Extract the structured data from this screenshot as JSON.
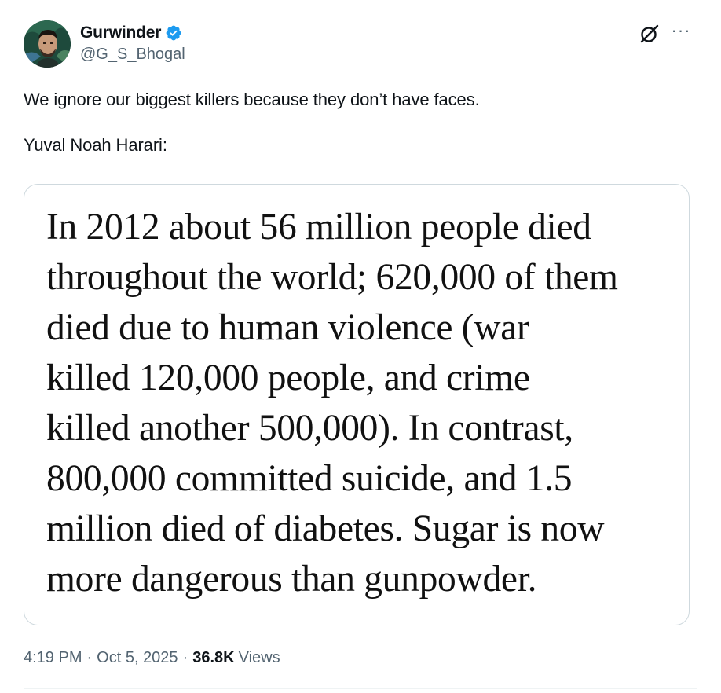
{
  "author": {
    "display_name": "Gurwinder",
    "handle": "@G_S_Bhogal",
    "verified": true,
    "verified_color": "#1d9bf0"
  },
  "icons": {
    "verified": "verified-badge-icon",
    "grok": "grok-icon",
    "more": "more-options-icon",
    "more_glyph": "···"
  },
  "tweet": {
    "text_line_1": "We ignore our biggest killers because they don’t have faces.",
    "text_line_2": "Yuval Noah Harari:"
  },
  "media": {
    "quote": "In 2012 about 56 million people died\nthroughout the world; 620,000 of them\ndied due to human violence (war\nkilled 120,000 people, and crime\nkilled another 500,000). In contrast,\n800,000 committed suicide, and 1.5\nmillion died of diabetes. Sugar is now\nmore dangerous than gunpowder."
  },
  "meta": {
    "time": "4:19 PM",
    "separator": "·",
    "date": "Oct 5, 2025",
    "views_count": "36.8K",
    "views_label": "Views"
  },
  "colors": {
    "text_primary": "#0f1419",
    "text_secondary": "#536471",
    "border": "#cfd9de"
  }
}
